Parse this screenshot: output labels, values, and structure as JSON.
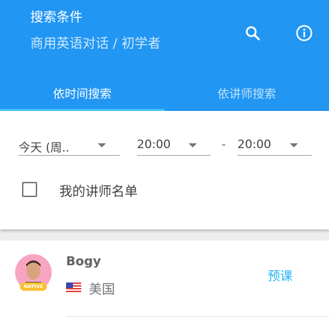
{
  "header": {
    "title": "搜索条件",
    "subtitle": "商用英语对话 / 初学者"
  },
  "tabs": [
    {
      "label": "依时间搜索",
      "active": true
    },
    {
      "label": "依讲师搜索",
      "active": false
    }
  ],
  "filters": {
    "day": "今天 (周..",
    "time_from": "20:00",
    "separator": "-",
    "time_to": "20:00",
    "my_teachers_label": "我的讲师名单",
    "my_teachers_checked": false
  },
  "teachers": [
    {
      "name": "Bogy",
      "badge": "NATIVE",
      "country": "美国",
      "action": "预课"
    }
  ],
  "colors": {
    "primary": "#2196f3",
    "tab_indicator": "#40c4ff",
    "action": "#29b6f6",
    "badge": "#fbc02d"
  },
  "icons": {
    "search": "search-icon",
    "info": "info-icon",
    "flag": "us-flag-icon"
  }
}
